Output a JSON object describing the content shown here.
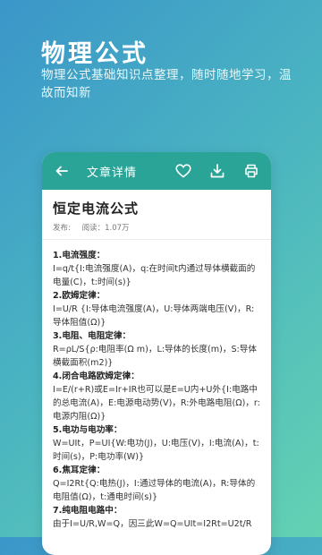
{
  "promo": {
    "title": "物理公式",
    "subtitle": "物理公式基础知识点整理，随时随地学习，温故而知新"
  },
  "appbar": {
    "title": "文章详情",
    "icons": [
      "back-arrow-icon",
      "heart-icon",
      "download-icon",
      "print-icon"
    ]
  },
  "article": {
    "title": "恒定电流公式",
    "publish_label": "发布:",
    "read_label": "阅读：1.07万",
    "sections": [
      {
        "heading": "1.电流强度：",
        "lines": [
          "I=q/t{I:电流强度(A)，q:在时间t内通过导体横截面的电量(C)，t:时间(s)}"
        ]
      },
      {
        "heading": "2.欧姆定律：",
        "lines": [
          "I=U/R {I:导体电流强度(A)，U:导体两端电压(V)，R:导体阻值(Ω)}"
        ]
      },
      {
        "heading": "3.电阻、电阻定律：",
        "lines": [
          "R=ρL/S{ρ:电阻率(Ω m)，L:导体的长度(m)，S:导体横截面积(m2)}"
        ]
      },
      {
        "heading": "4.闭合电路欧姆定律：",
        "lines": [
          "I=E/(r+R)或E=Ir+IR也可以是E=U内+U外{I:电路中的总电流(A)，E:电源电动势(V)，R:外电路电阻(Ω)，r:电源内阻(Ω)}"
        ]
      },
      {
        "heading": "5.电功与电功率：",
        "lines": [
          "W=UIt，P=UI{W:电功(J)，U:电压(V)，I:电流(A)，t:时间(s)，P:电功率(W)}"
        ]
      },
      {
        "heading": "6.焦耳定律：",
        "lines": [
          "Q=I2Rt{Q:电热(J)，I:通过导体的电流(A)，R:导体的电阻值(Ω)，t:通电时间(s)}"
        ]
      },
      {
        "heading": "7.纯电阻电路中：",
        "lines": [
          "由于I=U/R,W=Q，因三此W=Q=UIt=I2Rt=U2t/R"
        ]
      }
    ]
  },
  "colors": {
    "accent": "#2aa497",
    "gradient_start": "#3b96c9",
    "gradient_end": "#63d2b2"
  }
}
